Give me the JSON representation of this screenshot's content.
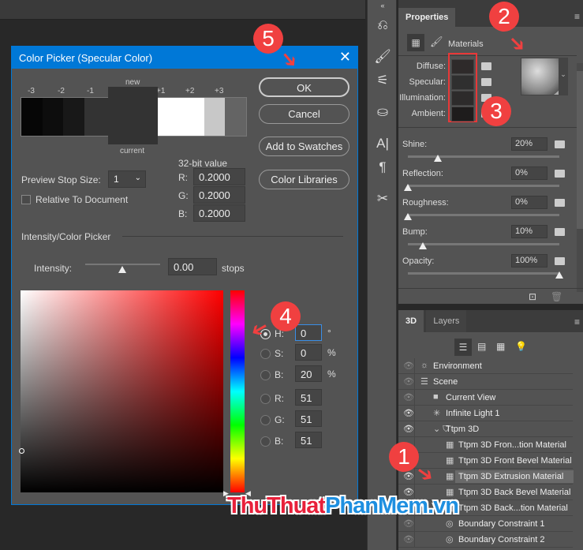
{
  "dialog": {
    "title": "Color Picker (Specular Color)",
    "new_label": "new",
    "current_label": "current",
    "stops": [
      "-3",
      "-2",
      "-1",
      "+1",
      "+2",
      "+3"
    ],
    "stop_colors": [
      "#060606",
      "#0d0d0d",
      "#181818",
      "#ffffff",
      "#c8c8c8",
      "#646464"
    ],
    "new_color": "#333333",
    "buttons": {
      "ok": "OK",
      "cancel": "Cancel",
      "add_swatches": "Add to Swatches",
      "libraries": "Color Libraries"
    },
    "preview_stop_label": "Preview Stop Size:",
    "preview_stop_value": "1",
    "relative_label": "Relative To Document",
    "bit_label": "32-bit value",
    "rgb32": [
      {
        "l": "R:",
        "v": "0.2000"
      },
      {
        "l": "G:",
        "v": "0.2000"
      },
      {
        "l": "B:",
        "v": "0.2000"
      }
    ],
    "section": "Intensity/Color Picker",
    "intensity_label": "Intensity:",
    "intensity_value": "0.00",
    "intensity_unit": "stops",
    "fields": [
      {
        "l": "H:",
        "v": "0",
        "u": "°",
        "selected": true
      },
      {
        "l": "S:",
        "v": "0",
        "u": "%"
      },
      {
        "l": "B:",
        "v": "20",
        "u": "%"
      },
      {
        "l": "R:",
        "v": "51",
        "u": ""
      },
      {
        "l": "G:",
        "v": "51",
        "u": ""
      },
      {
        "l": "B:",
        "v": "51",
        "u": ""
      }
    ]
  },
  "properties": {
    "tab": "Properties",
    "section": "Materials",
    "colors": [
      {
        "l": "Diffuse:",
        "c": "#2e2a2a"
      },
      {
        "l": "Specular:",
        "c": "#2f2f2f"
      },
      {
        "l": "Illumination:",
        "c": "#2d2b2b"
      },
      {
        "l": "Ambient:",
        "c": "#1e1c1c"
      }
    ],
    "sliders": [
      {
        "l": "Shine:",
        "v": "20%",
        "f": 0.2
      },
      {
        "l": "Reflection:",
        "v": "0%",
        "f": 0
      },
      {
        "l": "Roughness:",
        "v": "0%",
        "f": 0
      },
      {
        "l": "Bump:",
        "v": "10%",
        "f": 0.1
      },
      {
        "l": "Opacity:",
        "v": "100%",
        "f": 1
      }
    ]
  },
  "panel3d": {
    "tabs": [
      "3D",
      "Layers"
    ],
    "rows": [
      {
        "t": "Environment",
        "icon": "☼",
        "indent": 0,
        "eye": "dim"
      },
      {
        "t": "Scene",
        "icon": "☰",
        "indent": 0,
        "eye": "dim"
      },
      {
        "t": "Current View",
        "icon": "■",
        "indent": 1,
        "eye": "dim"
      },
      {
        "t": "Infinite Light 1",
        "icon": "✳",
        "indent": 1,
        "eye": "on"
      },
      {
        "t": "Ttpm 3D",
        "icon": "⌄ ⛉",
        "indent": 1,
        "eye": "on"
      },
      {
        "t": "Ttpm 3D  Fron...tion Material",
        "icon": "▦",
        "indent": 2,
        "eye": "none"
      },
      {
        "t": "Ttpm 3D  Front Bevel Material",
        "icon": "▦",
        "indent": 2,
        "eye": "none"
      },
      {
        "t": "Ttpm 3D  Extrusion Material",
        "icon": "▦",
        "indent": 2,
        "eye": "on",
        "selected": true
      },
      {
        "t": "Ttpm 3D  Back Bevel Material",
        "icon": "▦",
        "indent": 2,
        "eye": "on"
      },
      {
        "t": "Ttpm 3D  Back...tion Material",
        "icon": "▦",
        "indent": 2,
        "eye": "on"
      },
      {
        "t": "Boundary Constraint 1",
        "icon": "◎",
        "indent": 2,
        "eye": "dim"
      },
      {
        "t": "Boundary Constraint 2",
        "icon": "◎",
        "indent": 2,
        "eye": "dim"
      }
    ]
  },
  "annotations": [
    "1",
    "2",
    "3",
    "4",
    "5"
  ],
  "watermark": {
    "part1": "ThuThuat",
    "part2": "PhanMem.vn",
    "c1": "#e8203a",
    "c2": "#1e8fe0"
  }
}
